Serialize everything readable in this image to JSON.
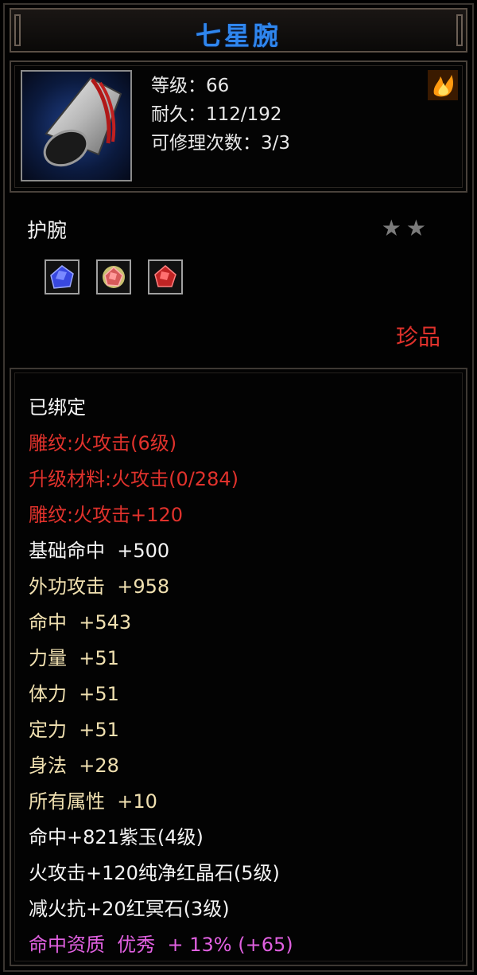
{
  "title": "七星腕",
  "header": {
    "item_icon": "bracer-icon",
    "level_label": "等级：66",
    "durability_label": "耐久：112/192",
    "repair_label": "可修理次数：3/3",
    "element_icon": "fire-icon"
  },
  "item_type": "护腕",
  "stars": "★★",
  "star_count": 2,
  "gems": [
    {
      "name": "purple-gem-icon",
      "color": "#4a5cff"
    },
    {
      "name": "jade-gem-icon",
      "color": "#d85a5a"
    },
    {
      "name": "red-gem-icon",
      "color": "#e03a3a"
    }
  ],
  "rarity": "珍品",
  "attributes": [
    {
      "text": "已绑定",
      "color": "white"
    },
    {
      "text": "雕纹:火攻击(6级)",
      "color": "red"
    },
    {
      "text": "升级材料:火攻击(0/284)",
      "color": "red"
    },
    {
      "text": "雕纹:火攻击+120",
      "color": "red"
    },
    {
      "text": "基础命中  +500",
      "color": "white"
    },
    {
      "text": "外功攻击  +958",
      "color": "tan"
    },
    {
      "text": "命中  +543",
      "color": "tan"
    },
    {
      "text": "力量  +51",
      "color": "tan"
    },
    {
      "text": "体力  +51",
      "color": "tan"
    },
    {
      "text": "定力  +51",
      "color": "tan"
    },
    {
      "text": "身法  +28",
      "color": "tan"
    },
    {
      "text": "所有属性  +10",
      "color": "tan"
    },
    {
      "text": "命中+821紫玉(4级)",
      "color": "white"
    },
    {
      "text": "火攻击+120纯净红晶石(5级)",
      "color": "white"
    },
    {
      "text": "减火抗+20红冥石(3级)",
      "color": "white"
    },
    {
      "text": "命中资质  优秀  + 13% (+65)",
      "color": "pink"
    }
  ],
  "colors": {
    "title": "#2f86ee",
    "red": "#e0322c",
    "tan": "#f0e0b0",
    "pink": "#e060e0",
    "white": "#f4f4f4"
  }
}
